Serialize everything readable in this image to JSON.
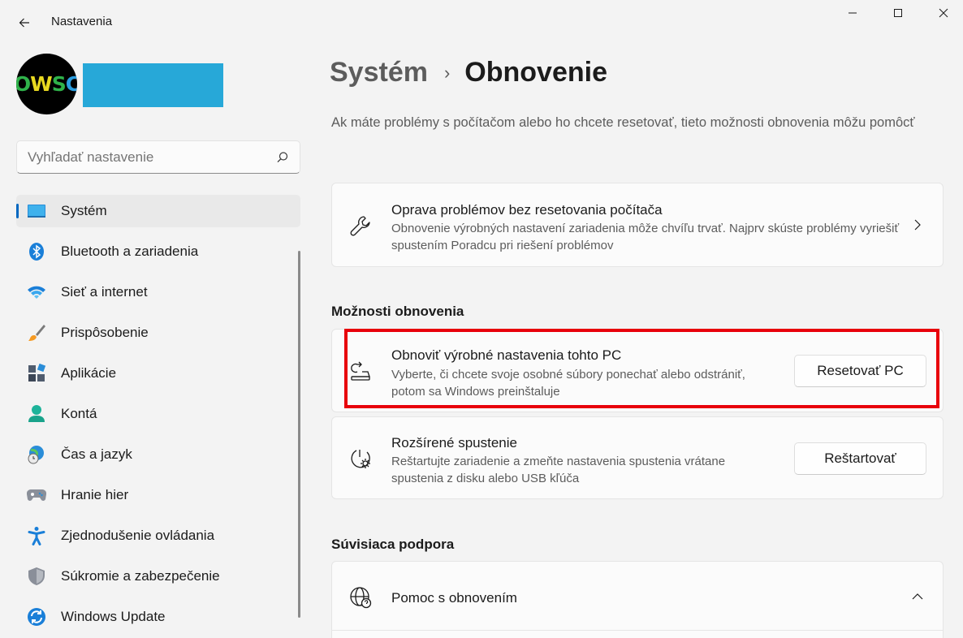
{
  "window": {
    "title": "Nastavenia",
    "back_icon": "arrow-left-icon",
    "minimize_icon": "minimize-icon",
    "maximize_icon": "maximize-icon",
    "close_icon": "close-icon"
  },
  "profile": {
    "avatar_text": [
      "O",
      "W",
      "S",
      "C"
    ],
    "name_color": "#27a8d8"
  },
  "search": {
    "placeholder": "Vyhľadať nastavenie",
    "icon": "search-icon"
  },
  "sidebar": {
    "items": [
      {
        "label": "Systém",
        "icon": "system-icon",
        "active": true
      },
      {
        "label": "Bluetooth a zariadenia",
        "icon": "bluetooth-icon"
      },
      {
        "label": "Sieť a internet",
        "icon": "wifi-icon"
      },
      {
        "label": "Prispôsobenie",
        "icon": "brush-icon"
      },
      {
        "label": "Aplikácie",
        "icon": "apps-icon"
      },
      {
        "label": "Kontá",
        "icon": "account-icon"
      },
      {
        "label": "Čas a jazyk",
        "icon": "time-language-icon"
      },
      {
        "label": "Hranie hier",
        "icon": "gamepad-icon"
      },
      {
        "label": "Zjednodušenie ovládania",
        "icon": "accessibility-icon"
      },
      {
        "label": "Súkromie a zabezpečenie",
        "icon": "shield-icon"
      },
      {
        "label": "Windows Update",
        "icon": "update-icon"
      }
    ]
  },
  "main": {
    "breadcrumb_parent": "Systém",
    "breadcrumb_sep": "›",
    "breadcrumb_current": "Obnovenie",
    "intro": "Ak máte problémy s počítačom alebo ho chcete resetovať, tieto možnosti obnovenia môžu pomôcť",
    "troubleshoot": {
      "title": "Oprava problémov bez resetovania počítača",
      "desc": "Obnovenie výrobných nastavení zariadenia môže chvíľu trvať. Najprv skúste problémy vyriešiť spustením Poradcu pri riešení problémov",
      "icon": "wrench-icon"
    },
    "recovery_section": "Možnosti obnovenia",
    "reset": {
      "title": "Obnoviť výrobné nastavenia tohto PC",
      "desc": "Vyberte, či chcete svoje osobné súbory ponechať alebo odstrániť, potom sa Windows preinštaluje",
      "button": "Resetovať PC",
      "icon": "reset-pc-icon"
    },
    "advanced": {
      "title": "Rozšírené spustenie",
      "desc": "Reštartujte zariadenie a zmeňte nastavenia spustenia vrátane spustenia z disku alebo USB kľúča",
      "button": "Reštartovať",
      "icon": "advanced-startup-icon"
    },
    "support_section": "Súvisiaca podpora",
    "help": {
      "title": "Pomoc s obnovením",
      "icon": "globe-help-icon"
    },
    "highlight_color": "#e8000b"
  }
}
